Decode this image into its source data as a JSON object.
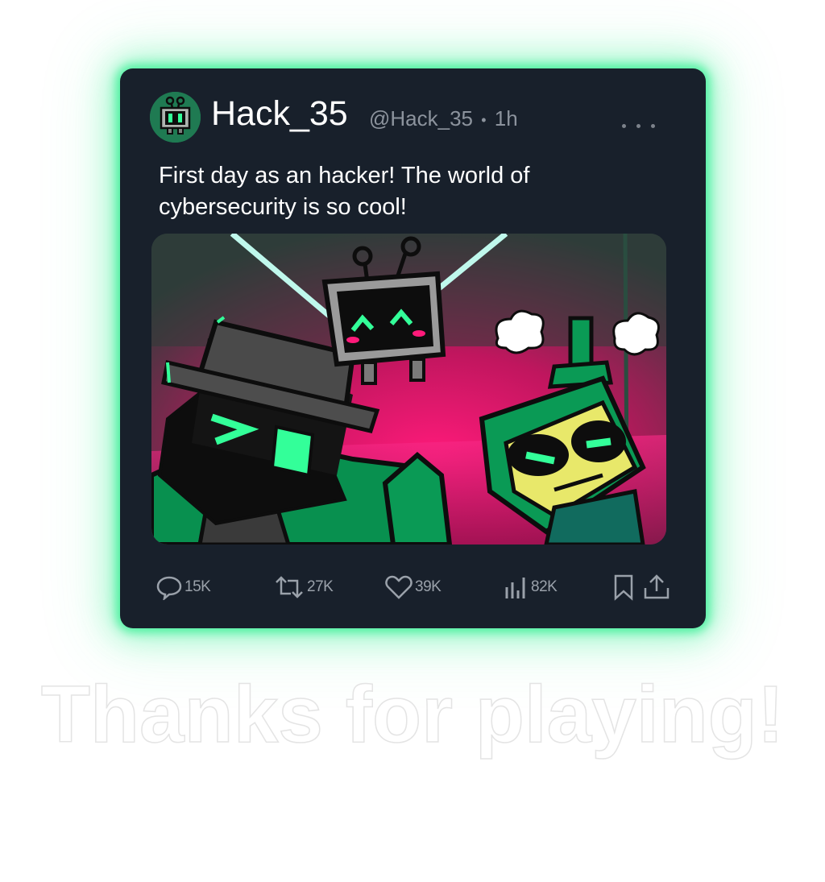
{
  "post": {
    "display_name": "Hack_35",
    "handle": "@Hack_35",
    "separator": "•",
    "time": "1h",
    "text": "First day as an hacker! The world of cybersecurity is so cool!",
    "more_icon": "ellipsis-icon",
    "avatar_icon": "robot-tv-avatar"
  },
  "actions": {
    "replies": {
      "icon": "reply-bubble-icon",
      "count": "15K"
    },
    "reposts": {
      "icon": "repost-icon",
      "count": "27K"
    },
    "likes": {
      "icon": "heart-icon",
      "count": "39K"
    },
    "views": {
      "icon": "bar-chart-icon",
      "count": "82K"
    },
    "bookmark": {
      "icon": "bookmark-icon"
    },
    "share": {
      "icon": "share-icon"
    }
  },
  "footer": {
    "message": "Thanks for playing!"
  },
  "colors": {
    "card_bg": "#18202b",
    "glow": "#3cf096",
    "accent_green": "#19e68c",
    "accent_pink": "#ff1a7a",
    "muted_text": "#8c939d"
  }
}
